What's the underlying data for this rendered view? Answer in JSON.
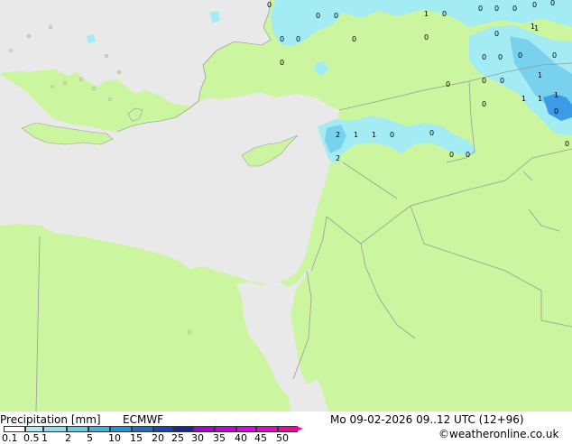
{
  "map": {
    "land_color": "#ccf5a0",
    "sea_color": "#e9e9e9",
    "border_color": "#9a9a9a",
    "precip_light_color": "#a4ecf4",
    "precip_mid_color": "#78d2ee",
    "precip_heavy_color": "#3c9be6",
    "cities": [
      {
        "label": "0"
      },
      {
        "label": "0"
      },
      {
        "label": "1"
      },
      {
        "label": "0"
      },
      {
        "label": "0"
      },
      {
        "label": "0"
      },
      {
        "label": "0"
      },
      {
        "label": "0"
      },
      {
        "label": "0"
      },
      {
        "label": "1"
      },
      {
        "label": "0"
      },
      {
        "label": "0"
      },
      {
        "label": "0"
      },
      {
        "label": "0"
      },
      {
        "label": "0"
      },
      {
        "label": "1"
      },
      {
        "label": "0"
      },
      {
        "label": "0"
      },
      {
        "label": "0"
      },
      {
        "label": "0"
      },
      {
        "label": "0"
      },
      {
        "label": "0"
      },
      {
        "label": "1"
      },
      {
        "label": "0"
      },
      {
        "label": "0"
      },
      {
        "label": "1"
      },
      {
        "label": "1"
      },
      {
        "label": "1"
      },
      {
        "label": "0"
      },
      {
        "label": "0"
      },
      {
        "label": "0"
      },
      {
        "label": "2"
      },
      {
        "label": "1"
      },
      {
        "label": "1"
      },
      {
        "label": "0"
      },
      {
        "label": "0"
      },
      {
        "label": "2"
      },
      {
        "label": "0"
      },
      {
        "label": "0"
      },
      {
        "label": "0"
      }
    ]
  },
  "footer": {
    "title": "Precipitation [mm]",
    "model": "ECMWF",
    "datetime": "Mo 09-02-2026 09..12 UTC (12+96)",
    "credit": "©weatheronline.co.uk"
  },
  "legend": {
    "ticks": [
      "0.1",
      "0.5",
      "1",
      "2",
      "5",
      "10",
      "15",
      "20",
      "25",
      "30",
      "35",
      "40",
      "45",
      "50"
    ],
    "colors": [
      "#ffffff",
      "#a8eef6",
      "#86e0f0",
      "#62cdec",
      "#3cb4e4",
      "#1e96dc",
      "#1e6ec8",
      "#1a46b4",
      "#142898",
      "#aa00d2",
      "#c800dc",
      "#e000e6",
      "#f000c8",
      "#ff00a0"
    ]
  }
}
